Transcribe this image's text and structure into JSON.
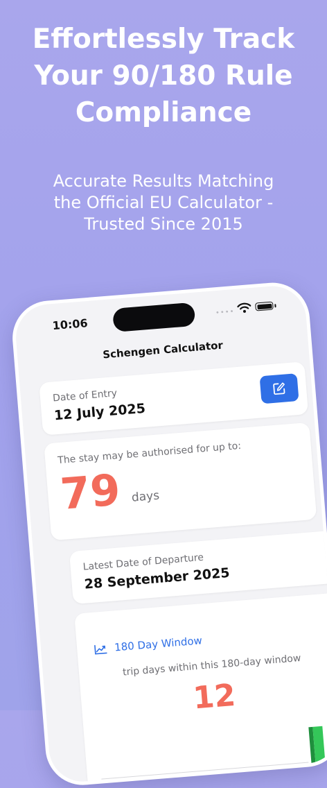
{
  "marketing": {
    "headline_lines": [
      "Effortlessly Track",
      "Your 90/180 Rule",
      "Compliance"
    ],
    "subheadline_lines": [
      "Accurate Results Matching",
      "the Official EU Calculator -",
      "Trusted Since 2015"
    ]
  },
  "status_bar": {
    "time": "10:06",
    "dots": "••••"
  },
  "nav": {
    "title": "Schengen Calculator"
  },
  "entry_card": {
    "label": "Date of Entry",
    "value": "12 July 2025",
    "edit_icon": "edit-icon"
  },
  "stay_card": {
    "label": "The stay may be authorised for up to:",
    "number": "79",
    "unit": "days"
  },
  "departure_card": {
    "label": "Latest Date of Departure",
    "value": "28 September 2025"
  },
  "window_card": {
    "title": "180 Day Window",
    "subtitle": "trip days within this 180-day window",
    "count": "12",
    "icon": "chart-line-icon",
    "collapse_icon": "chevron-up-icon"
  },
  "colors": {
    "background": "#a5a4ec",
    "accent_blue": "#2f6fe6",
    "highlight_red": "#f26b5b",
    "bar_green": "#34c759"
  }
}
